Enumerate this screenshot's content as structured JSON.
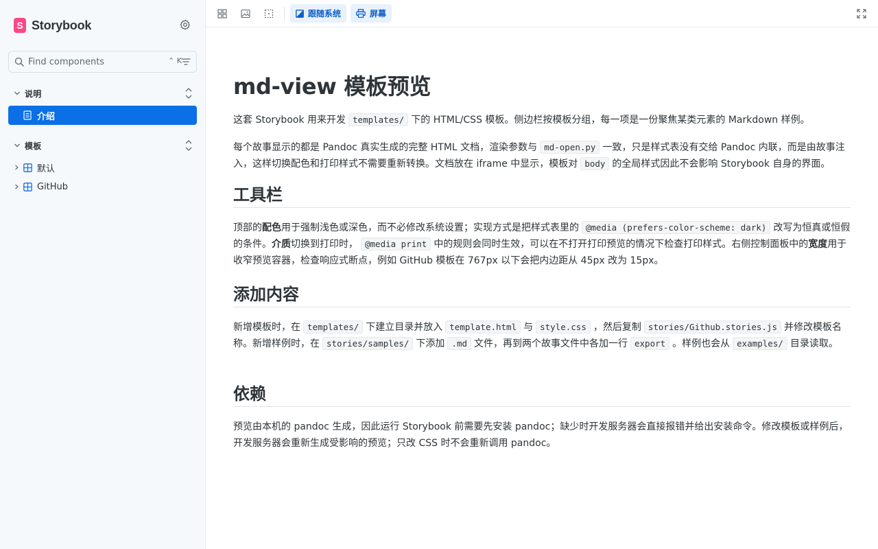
{
  "sidebar": {
    "brand": "Storybook",
    "brand_logo_letter": "S",
    "search_placeholder": "Find components",
    "search_shortcut": "⌃ K",
    "groups": [
      {
        "label": "说明",
        "items": [
          {
            "label": "介绍",
            "active": true
          }
        ]
      },
      {
        "label": "模板",
        "items": [
          {
            "label": "默认"
          },
          {
            "label": "GitHub"
          }
        ]
      }
    ]
  },
  "toolbar": {
    "color_scheme_label": "跟随系统",
    "media_label": "屏幕",
    "accent": "#0b5fc7"
  },
  "content": {
    "title": "md-view 模板预览",
    "intro_1": {
      "t1": "这套 Storybook 用来开发",
      "c1": "templates/",
      "t2": "下的 HTML/CSS 模板。侧边栏按模板分组，每一项是一份聚焦某类元素的 Markdown 样例。"
    },
    "intro_2": {
      "t1": "每个故事显示的都是 Pandoc 真实生成的完整 HTML 文档，渲染参数与",
      "c1": "md-open.py",
      "t2": "一致，只是样式表没有交给 Pandoc 内联，而是由故事注入，这样切换配色和打印样式不需要重新转换。文档放在 iframe 中显示，模板对",
      "c2": "body",
      "t3": "的全局样式因此不会影响 Storybook 自身的界面。"
    },
    "h_toolbar": "工具栏",
    "toolbar_p": {
      "t1": "顶部的",
      "b1": "配色",
      "t2": "用于强制浅色或深色，而不必修改系统设置；实现方式是把样式表里的",
      "c1": "@media (prefers-color-scheme: dark)",
      "t3": "改写为恒真或恒假的条件。",
      "b2": "介质",
      "t4": "切换到打印时，",
      "c2": "@media print",
      "t5": "中的规则会同时生效，可以在不打开打印预览的情况下检查打印样式。右侧控制面板中的",
      "b3": "宽度",
      "t6": "用于收窄预览容器，检查响应式断点，例如 GitHub 模板在 767px 以下会把内边距从 45px 改为 15px。"
    },
    "h_add": "添加内容",
    "add_p": {
      "t1": "新增模板时，在",
      "c1": "templates/",
      "t2": "下建立目录并放入",
      "c2": "template.html",
      "t3": "与",
      "c3": "style.css",
      "t4": "，然后复制",
      "c4": "stories/Github.stories.js",
      "t5": "并修改模板名称。新增样例时，在",
      "c5": "stories/samples/",
      "t6": "下添加",
      "c6": ".md",
      "t7": "文件，再到两个故事文件中各加一行",
      "c7": "export",
      "t8": "。样例也会从",
      "c8": "examples/",
      "t9": "目录读取。"
    },
    "h_deps": "依赖",
    "deps_p": "预览由本机的 pandoc 生成，因此运行 Storybook 前需要先安装 pandoc；缺少时开发服务器会直接报错并给出安装命令。修改模板或样例后，开发服务器会重新生成受影响的预览；只改 CSS 时不会重新调用 pandoc。"
  }
}
